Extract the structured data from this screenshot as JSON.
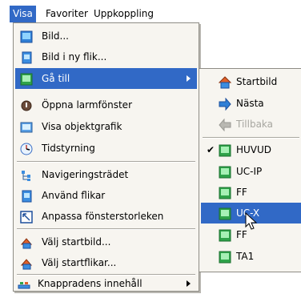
{
  "menubar": {
    "items": [
      "Visa",
      "Favoriter",
      "Uppkoppling"
    ]
  },
  "menu": {
    "items": [
      {
        "label": "Bild...",
        "icon": "picture-icon"
      },
      {
        "label": "Bild i ny flik...",
        "icon": "document-icon"
      },
      {
        "label": "Gå till",
        "icon": "goto-picture-icon",
        "submenu": true,
        "selected": true
      },
      {
        "label": "Öppna larmfönster",
        "icon": "alarm-icon"
      },
      {
        "label": "Visa objektgrafik",
        "icon": "object-graphic-icon"
      },
      {
        "label": "Tidstyrning",
        "icon": "clock-icon"
      },
      {
        "label": "Navigeringsträdet",
        "icon": "tree-icon"
      },
      {
        "label": "Använd flikar",
        "icon": "tabs-icon"
      },
      {
        "label": "Anpassa fönsterstorleken",
        "icon": "resize-icon"
      },
      {
        "label": "Välj startbild...",
        "icon": "start-picture-icon"
      },
      {
        "label": "Välj startflikar...",
        "icon": "start-tabs-icon"
      },
      {
        "label": "Knappradens innehåll",
        "icon": "toolbar-icon",
        "submenu": true
      }
    ]
  },
  "submenu": {
    "items": [
      {
        "label": "Startbild",
        "icon": "home-icon"
      },
      {
        "label": "Nästa",
        "icon": "forward-icon"
      },
      {
        "label": "Tillbaka",
        "icon": "back-icon",
        "disabled": true
      },
      {
        "label": "HUVUD",
        "icon": "picture-icon",
        "checked": true
      },
      {
        "label": "UC-IP",
        "icon": "picture-icon"
      },
      {
        "label": "FF",
        "icon": "picture-icon"
      },
      {
        "label": "UC-X",
        "icon": "picture-icon",
        "selected": true
      },
      {
        "label": "FF",
        "icon": "picture-icon"
      },
      {
        "label": "TA1",
        "icon": "picture-icon"
      }
    ],
    "check_mark": "✔"
  },
  "colors": {
    "highlight": "#3169c6",
    "menu_bg": "#f7f5f0",
    "disabled": "#a7a6a0"
  }
}
